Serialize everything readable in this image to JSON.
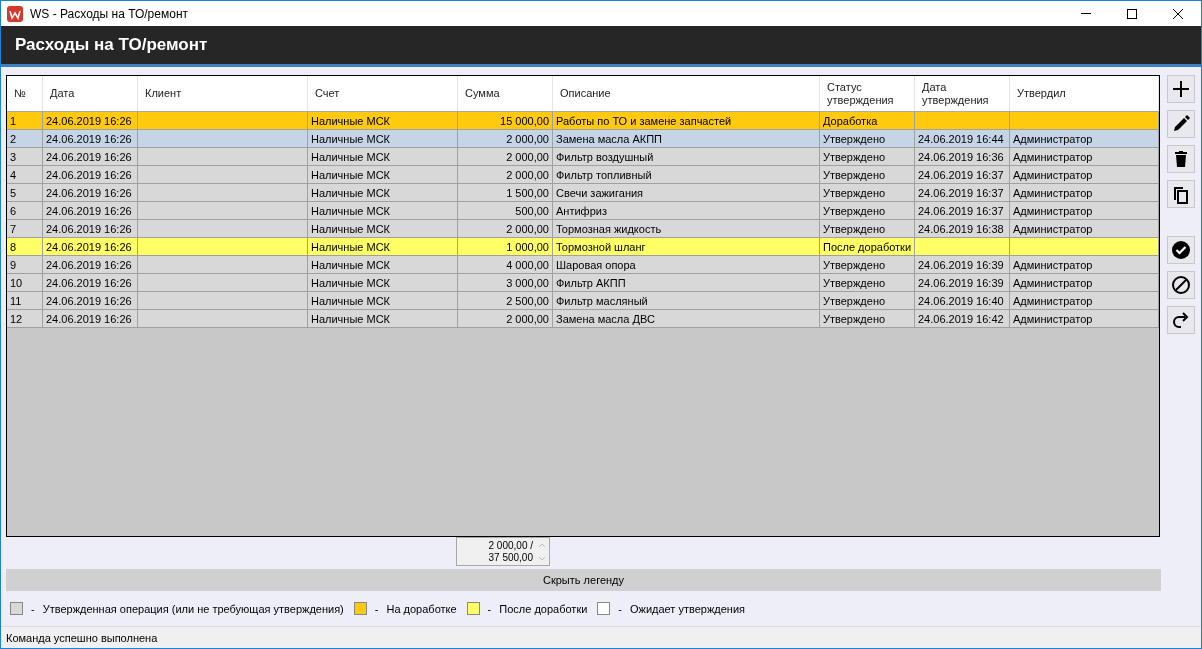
{
  "window": {
    "title": "WS - Расходы на ТО/ремонт"
  },
  "header": {
    "title": "Расходы на ТО/ремонт"
  },
  "table": {
    "columns": [
      "№",
      "Дата",
      "Клиент",
      "Счет",
      "Сумма",
      "Описание",
      "Статус утверждения",
      "Дата утверждения",
      "Утвердил"
    ],
    "rows": [
      {
        "kind": "rework",
        "selected": false,
        "cells": [
          "1",
          "24.06.2019 16:26",
          "",
          "Наличные МСК",
          "15 000,00",
          "Работы по ТО и замене запчастей",
          "Доработка",
          "",
          ""
        ]
      },
      {
        "kind": "approved",
        "selected": true,
        "cells": [
          "2",
          "24.06.2019 16:26",
          "",
          "Наличные МСК",
          "2 000,00",
          "Замена масла АКПП",
          "Утверждено",
          "24.06.2019 16:44",
          "Администратор"
        ]
      },
      {
        "kind": "approved",
        "selected": false,
        "cells": [
          "3",
          "24.06.2019 16:26",
          "",
          "Наличные МСК",
          "2 000,00",
          "Фильтр воздушный",
          "Утверждено",
          "24.06.2019 16:36",
          "Администратор"
        ]
      },
      {
        "kind": "approved",
        "selected": false,
        "cells": [
          "4",
          "24.06.2019 16:26",
          "",
          "Наличные МСК",
          "2 000,00",
          "Фильтр топливный",
          "Утверждено",
          "24.06.2019 16:37",
          "Администратор"
        ]
      },
      {
        "kind": "approved",
        "selected": false,
        "cells": [
          "5",
          "24.06.2019 16:26",
          "",
          "Наличные МСК",
          "1 500,00",
          "Свечи зажигания",
          "Утверждено",
          "24.06.2019 16:37",
          "Администратор"
        ]
      },
      {
        "kind": "approved",
        "selected": false,
        "cells": [
          "6",
          "24.06.2019 16:26",
          "",
          "Наличные МСК",
          "500,00",
          "Антифриз",
          "Утверждено",
          "24.06.2019 16:37",
          "Администратор"
        ]
      },
      {
        "kind": "approved",
        "selected": false,
        "cells": [
          "7",
          "24.06.2019 16:26",
          "",
          "Наличные МСК",
          "2 000,00",
          "Тормозная жидкость",
          "Утверждено",
          "24.06.2019 16:38",
          "Администратор"
        ]
      },
      {
        "kind": "after_rework",
        "selected": false,
        "cells": [
          "8",
          "24.06.2019 16:26",
          "",
          "Наличные МСК",
          "1 000,00",
          "Тормозной шланг",
          "После доработки",
          "",
          ""
        ]
      },
      {
        "kind": "approved",
        "selected": false,
        "cells": [
          "9",
          "24.06.2019 16:26",
          "",
          "Наличные МСК",
          "4 000,00",
          "Шаровая опора",
          "Утверждено",
          "24.06.2019 16:39",
          "Администратор"
        ]
      },
      {
        "kind": "approved",
        "selected": false,
        "cells": [
          "10",
          "24.06.2019 16:26",
          "",
          "Наличные МСК",
          "3 000,00",
          "Фильтр АКПП",
          "Утверждено",
          "24.06.2019 16:39",
          "Администратор"
        ]
      },
      {
        "kind": "approved",
        "selected": false,
        "cells": [
          "11",
          "24.06.2019 16:26",
          "",
          "Наличные МСК",
          "2 500,00",
          "Фильтр масляный",
          "Утверждено",
          "24.06.2019 16:40",
          "Администратор"
        ]
      },
      {
        "kind": "approved",
        "selected": false,
        "cells": [
          "12",
          "24.06.2019 16:26",
          "",
          "Наличные МСК",
          "2 000,00",
          "Замена масла ДВС",
          "Утверждено",
          "24.06.2019 16:42",
          "Администратор"
        ]
      }
    ]
  },
  "totals": {
    "selected_sum": "2 000,00 /",
    "total_sum": "37 500,00"
  },
  "legend_toggle": {
    "label": "Скрыть легенду"
  },
  "legend": [
    {
      "color": "#d8d8d8",
      "dash": "-",
      "label": "Утвержденная операция (или не требующая утверждения)"
    },
    {
      "color": "#ffc90e",
      "dash": "-",
      "label": "На доработке"
    },
    {
      "color": "#ffff66",
      "dash": "-",
      "label": "После доработки"
    },
    {
      "color": "#ffffff",
      "dash": "-",
      "label": "Ожидает утверждения"
    }
  ],
  "status_bar": {
    "text": "Команда успешно выполнена"
  }
}
